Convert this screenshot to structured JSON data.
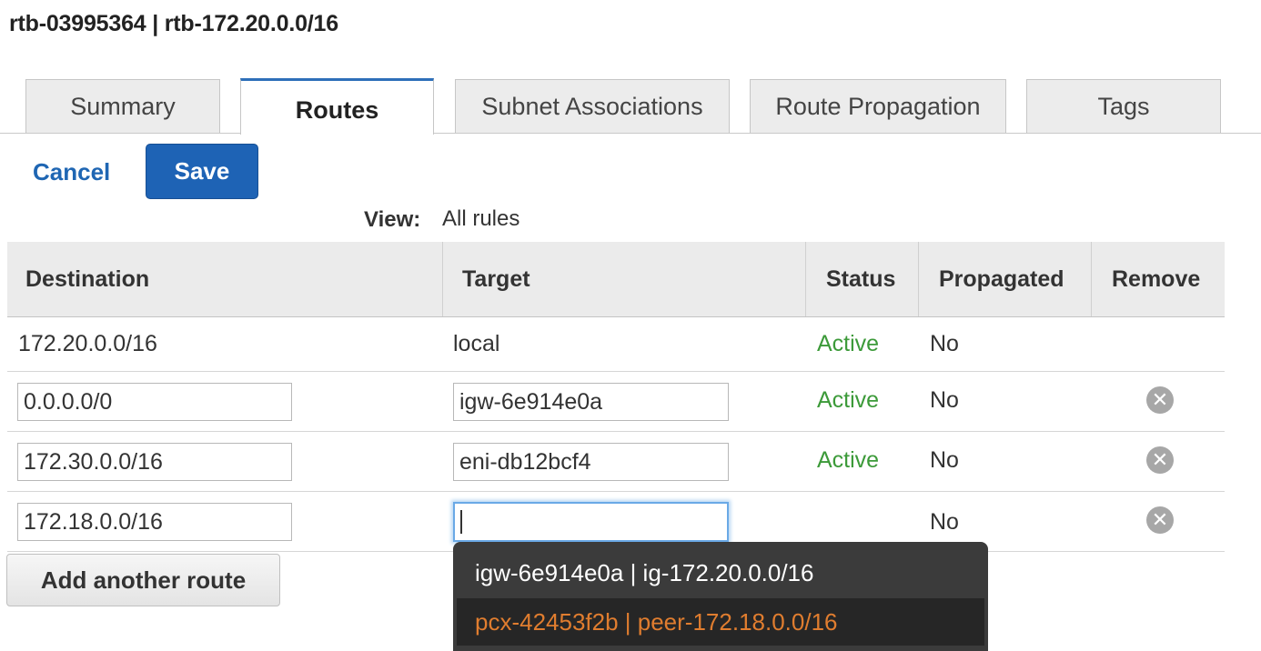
{
  "header": {
    "title": "rtb-03995364 | rtb-172.20.0.0/16"
  },
  "tabs": [
    {
      "label": "Summary",
      "active": false
    },
    {
      "label": "Routes",
      "active": true
    },
    {
      "label": "Subnet Associations",
      "active": false
    },
    {
      "label": "Route Propagation",
      "active": false
    },
    {
      "label": "Tags",
      "active": false
    }
  ],
  "actions": {
    "cancel_label": "Cancel",
    "save_label": "Save"
  },
  "view": {
    "label": "View:",
    "value": "All rules"
  },
  "table": {
    "columns": [
      "Destination",
      "Target",
      "Status",
      "Propagated",
      "Remove"
    ],
    "rows": [
      {
        "destination": "172.20.0.0/16",
        "target": "local",
        "status": "Active",
        "propagated": "No",
        "editable": false
      },
      {
        "destination": "0.0.0.0/0",
        "target": "igw-6e914e0a",
        "status": "Active",
        "propagated": "No",
        "editable": true
      },
      {
        "destination": "172.30.0.0/16",
        "target": "eni-db12bcf4",
        "status": "Active",
        "propagated": "No",
        "editable": true
      },
      {
        "destination": "172.18.0.0/16",
        "target": "",
        "status": "",
        "propagated": "No",
        "editable": true
      }
    ]
  },
  "add_route_label": "Add another route",
  "dropdown": {
    "options": [
      "igw-6e914e0a | ig-172.20.0.0/16",
      "pcx-42453f2b | peer-172.18.0.0/16"
    ],
    "highlighted_index": 1
  },
  "colors": {
    "accent": "#1e63b5",
    "status_active": "#3c9a39",
    "dropdown_highlight": "#e07d2f",
    "dropdown_bg": "#3b3b3b"
  },
  "icons": {
    "remove": "remove-circle-x-icon"
  }
}
